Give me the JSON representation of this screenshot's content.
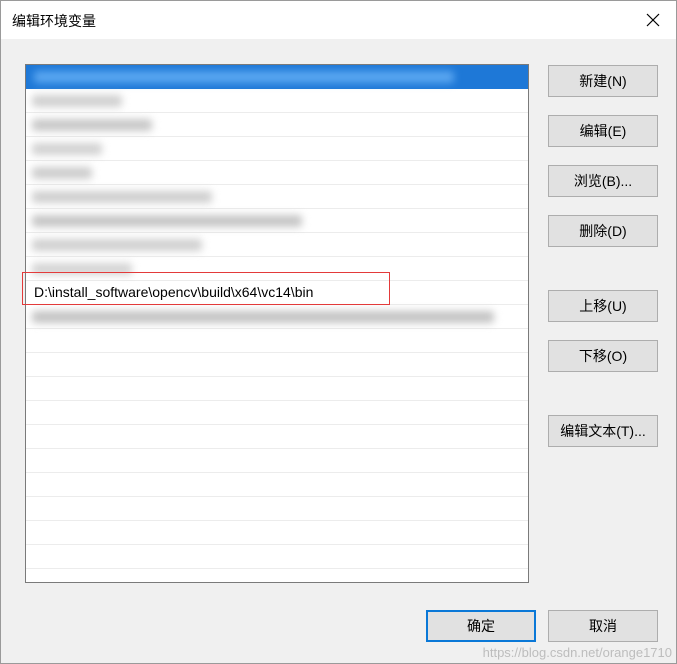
{
  "window": {
    "title": "编辑环境变量"
  },
  "list": {
    "visible_path": "D:\\install_software\\opencv\\build\\x64\\vc14\\bin"
  },
  "buttons": {
    "new": "新建(N)",
    "edit": "编辑(E)",
    "browse": "浏览(B)...",
    "delete": "删除(D)",
    "move_up": "上移(U)",
    "move_down": "下移(O)",
    "edit_text": "编辑文本(T)...",
    "ok": "确定",
    "cancel": "取消"
  },
  "watermark": "https://blog.csdn.net/orange1710",
  "colors": {
    "selection": "#1e78d7",
    "highlight_box": "#e33a3a",
    "ok_border": "#0a78d7"
  }
}
